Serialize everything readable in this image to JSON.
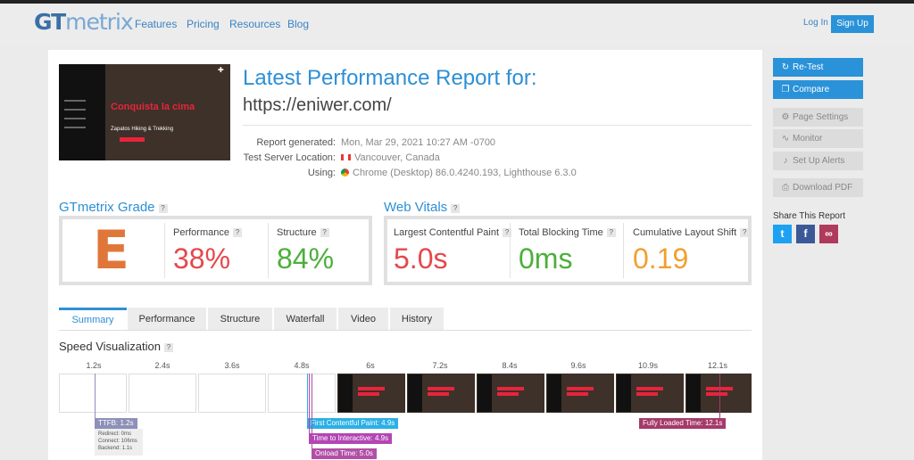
{
  "header": {
    "logo_bold": "GT",
    "logo_rest": "metrix",
    "nav": [
      "Features",
      "Pricing",
      "Resources",
      "Blog"
    ],
    "login": "Log In",
    "signup": "Sign Up"
  },
  "report": {
    "thumbnail": {
      "headline": "Conquista la cima",
      "tagline": "Zapatos Hiking & Trekking"
    },
    "title": "Latest Performance Report for:",
    "url": "https://eniwer.com/",
    "rows": [
      {
        "label": "Report generated:",
        "value": "Mon, Mar 29, 2021 10:27 AM -0700"
      },
      {
        "label": "Test Server Location:",
        "value": "Vancouver, Canada"
      },
      {
        "label": "Using:",
        "value": "Chrome (Desktop) 86.0.4240.193, Lighthouse 6.3.0"
      }
    ]
  },
  "grade": {
    "title": "GTmetrix Grade",
    "help": "?",
    "letter": "E",
    "performance_label": "Performance",
    "performance_value": "38%",
    "structure_label": "Structure",
    "structure_value": "84%"
  },
  "vitals": {
    "title": "Web Vitals",
    "help": "?",
    "lcp_label": "Largest Contentful Paint",
    "lcp_value": "5.0s",
    "tbt_label": "Total Blocking Time",
    "tbt_value": "0ms",
    "cls_label": "Cumulative Layout Shift",
    "cls_value": "0.19"
  },
  "tabs": [
    "Summary",
    "Performance",
    "Structure",
    "Waterfall",
    "Video",
    "History"
  ],
  "speed": {
    "title": "Speed Visualization",
    "help": "?",
    "ticks": [
      "1.2s",
      "2.4s",
      "3.6s",
      "4.8s",
      "6s",
      "7.2s",
      "8.4s",
      "9.6s",
      "10.9s",
      "12.1s"
    ],
    "ttfb": "TTFB: 1.2s",
    "ttfb_details": [
      "Redirect: 0ms",
      "Connect: 106ms",
      "Backend: 1.1s"
    ],
    "fcp": "First Contentful Paint: 4.9s",
    "tti": "Time to Interactive: 4.9s",
    "onload": "Onload Time: 5.0s",
    "fully_loaded": "Fully Loaded Time: 12.1s"
  },
  "sidebar": {
    "retest": "Re-Test",
    "compare": "Compare",
    "page_settings": "Page Settings",
    "monitor": "Monitor",
    "setup_alerts": "Set Up Alerts",
    "download_pdf": "Download PDF",
    "share_title": "Share This Report"
  },
  "colors": {
    "accent": "#2d8fd5",
    "grade": "#e0773a",
    "bad": "#e5484d",
    "good": "#4caf3a",
    "warn": "#f0a030",
    "ttfb": "#8d90b8",
    "fcp": "#2bb0e6",
    "tti": "#b246b4",
    "onload": "#b24fa6",
    "fully": "#a53a6a"
  }
}
